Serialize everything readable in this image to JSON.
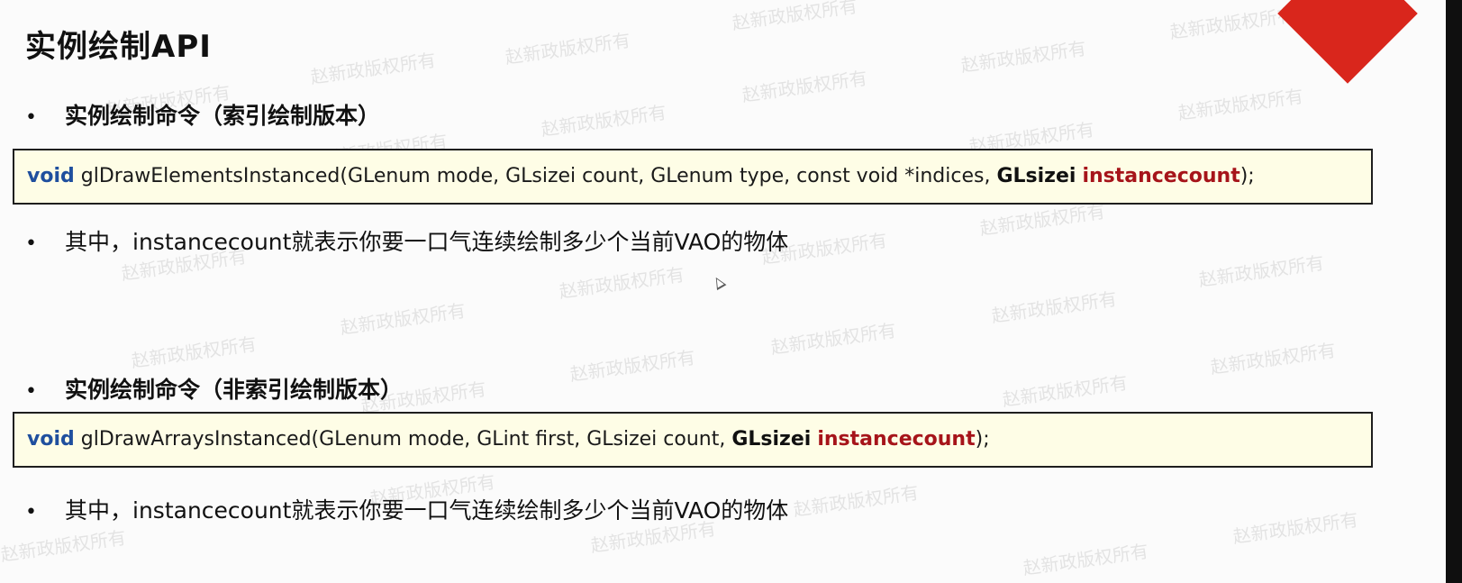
{
  "title": "实例绘制API",
  "watermark_text": "赵新政版权所有",
  "sections": [
    {
      "bullet": "•",
      "heading": "实例绘制命令（索引绘制版本）",
      "code": {
        "keyword": "void",
        "signature_plain": " glDrawElementsInstanced(GLenum mode, GLsizei count, GLenum type, const void *indices, ",
        "last_type": "GLsizei",
        "last_param": "instancecount",
        "end": ");"
      },
      "note_bullet": "•",
      "note": "其中，instancecount就表示你要一口气连续绘制多少个当前VAO的物体"
    },
    {
      "bullet": "•",
      "heading": "实例绘制命令（非索引绘制版本）",
      "code": {
        "keyword": "void",
        "signature_plain": " glDrawArraysInstanced(GLenum mode, GLint first, GLsizei count, ",
        "last_type": "GLsizei",
        "last_param": "instancecount",
        "end": ");"
      },
      "note_bullet": "•",
      "note": "其中，instancecount就表示你要一口气连续绘制多少个当前VAO的物体"
    }
  ],
  "colors": {
    "keyword": "#1f4f9e",
    "param_highlight": "#a6141a",
    "code_background": "#fefde6",
    "corner_accent": "#d9261c"
  },
  "icons": [
    "mouse-cursor-icon"
  ]
}
